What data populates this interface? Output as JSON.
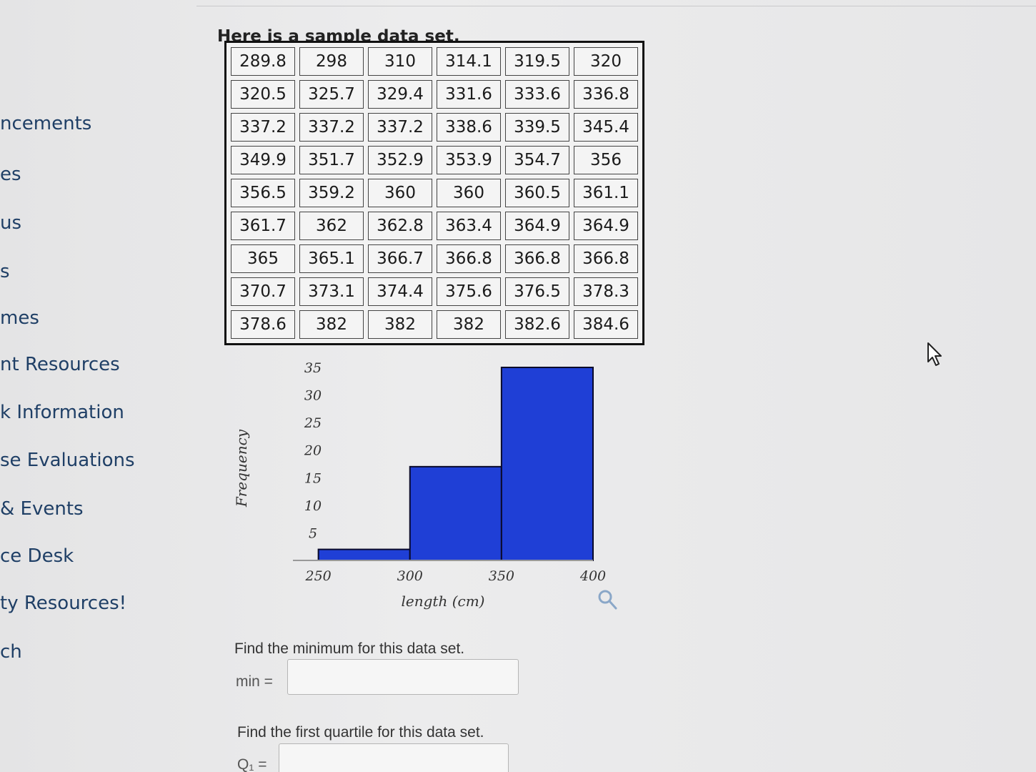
{
  "sidebar": {
    "items": [
      "ncements",
      "es",
      "us",
      "s",
      "mes",
      "nt Resources",
      "k Information",
      "se Evaluations",
      "& Events",
      "ce Desk",
      "ty Resources!",
      "ch"
    ]
  },
  "question": {
    "intro": "Here is a sample data set.",
    "data_rows": [
      [
        "289.8",
        "298",
        "310",
        "314.1",
        "319.5",
        "320"
      ],
      [
        "320.5",
        "325.7",
        "329.4",
        "331.6",
        "333.6",
        "336.8"
      ],
      [
        "337.2",
        "337.2",
        "337.2",
        "338.6",
        "339.5",
        "345.4"
      ],
      [
        "349.9",
        "351.7",
        "352.9",
        "353.9",
        "354.7",
        "356"
      ],
      [
        "356.5",
        "359.2",
        "360",
        "360",
        "360.5",
        "361.1"
      ],
      [
        "361.7",
        "362",
        "362.8",
        "363.4",
        "364.9",
        "364.9"
      ],
      [
        "365",
        "365.1",
        "366.7",
        "366.8",
        "366.8",
        "366.8"
      ],
      [
        "370.7",
        "373.1",
        "374.4",
        "375.6",
        "376.5",
        "378.3"
      ],
      [
        "378.6",
        "382",
        "382",
        "382",
        "382.6",
        "384.6"
      ]
    ],
    "min_prompt": "Find the minimum for this data set.",
    "min_label": "min =",
    "q1_prompt": "Find the first quartile for this data set.",
    "q1_label": "Q₁ ="
  },
  "chart_data": {
    "type": "bar",
    "title": "",
    "xlabel": "length (cm)",
    "ylabel": "Frequency",
    "x_ticks": [
      "250",
      "300",
      "350",
      "400"
    ],
    "y_ticks": [
      "5",
      "10",
      "15",
      "20",
      "25",
      "30",
      "35"
    ],
    "bins": [
      {
        "start": 250,
        "end": 300,
        "count": 2
      },
      {
        "start": 300,
        "end": 350,
        "count": 17
      },
      {
        "start": 350,
        "end": 400,
        "count": 35
      }
    ],
    "xlim": [
      240,
      400
    ],
    "ylim": [
      0,
      35
    ],
    "bar_color": "#1f3fd6"
  },
  "colors": {
    "nav_text": "#1f3f66",
    "bar_fill": "#1f3fd6"
  }
}
